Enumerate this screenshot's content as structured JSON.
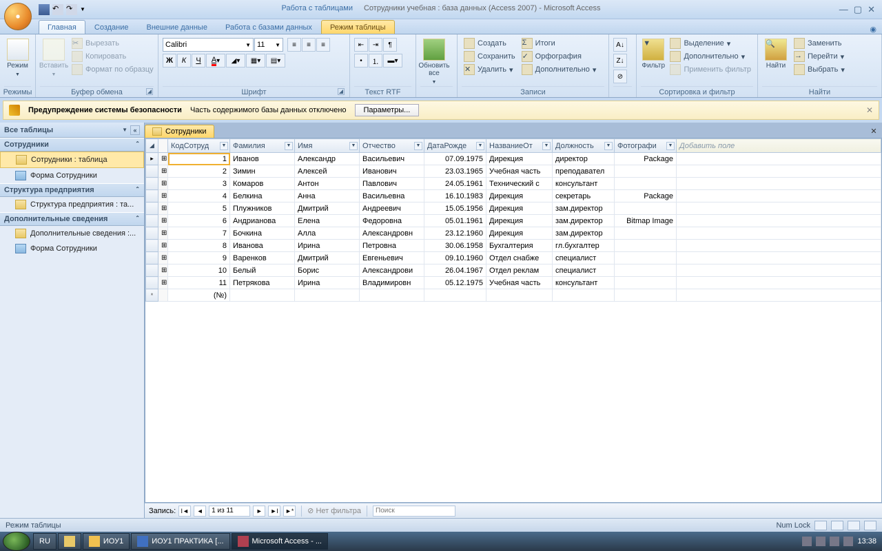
{
  "title": {
    "context_tab": "Работа с таблицами",
    "document": "Сотрудники учебная : база данных (Access 2007) - Microsoft Access"
  },
  "tabs": {
    "home": "Главная",
    "create": "Создание",
    "external": "Внешние данные",
    "dbtools": "Работа с базами данных",
    "tablemode": "Режим таблицы"
  },
  "ribbon": {
    "mode": "Режим",
    "modes": "Режимы",
    "paste": "Вставить",
    "cut": "Вырезать",
    "copy": "Копировать",
    "formatpainter": "Формат по образцу",
    "clipboard": "Буфер обмена",
    "font_name": "Calibri",
    "font_size": "11",
    "font": "Шрифт",
    "rtf": "Текст RTF",
    "refresh": "Обновить все",
    "new": "Создать",
    "save": "Сохранить",
    "delete": "Удалить",
    "totals": "Итоги",
    "spelling": "Орфография",
    "more": "Дополнительно",
    "records": "Записи",
    "filter": "Фильтр",
    "selection": "Выделение",
    "advanced": "Дополнительно",
    "toggle": "Применить фильтр",
    "sortfilter": "Сортировка и фильтр",
    "find": "Найти",
    "replace": "Заменить",
    "goto": "Перейти",
    "select": "Выбрать",
    "findgrp": "Найти"
  },
  "security": {
    "title": "Предупреждение системы безопасности",
    "msg": "Часть содержимого базы данных отключено",
    "btn": "Параметры..."
  },
  "nav": {
    "header": "Все таблицы",
    "g1": "Сотрудники",
    "g1i1": "Сотрудники : таблица",
    "g1i2": "Форма Сотрудники",
    "g2": "Структура предприятия",
    "g2i1": "Структура предприятия : та...",
    "g3": "Дополнительные сведения",
    "g3i1": "Дополнительные сведения :...",
    "g3i2": "Форма Сотрудники"
  },
  "doc_tab": "Сотрудники",
  "columns": [
    "КодСотруд",
    "Фамилия",
    "Имя",
    "Отчество",
    "ДатаРожде",
    "НазваниеОт",
    "Должность",
    "Фотографи"
  ],
  "addcol": "Добавить поле",
  "rows": [
    {
      "id": "1",
      "f": "Иванов",
      "i": "Александр",
      "o": "Васильевич",
      "d": "07.09.1975",
      "dep": "Дирекция",
      "pos": "директор",
      "ph": "Package"
    },
    {
      "id": "2",
      "f": "Зимин",
      "i": "Алексей",
      "o": "Иванович",
      "d": "23.03.1965",
      "dep": "Учебная часть",
      "pos": "преподавател",
      "ph": ""
    },
    {
      "id": "3",
      "f": "Комаров",
      "i": "Антон",
      "o": "Павлович",
      "d": "24.05.1961",
      "dep": "Технический с",
      "pos": "консультант",
      "ph": ""
    },
    {
      "id": "4",
      "f": "Белкина",
      "i": "Анна",
      "o": "Васильевна",
      "d": "16.10.1983",
      "dep": "Дирекция",
      "pos": "секретарь",
      "ph": "Package"
    },
    {
      "id": "5",
      "f": "Плужников",
      "i": "Дмитрий",
      "o": "Андреевич",
      "d": "15.05.1956",
      "dep": "Дирекция",
      "pos": "зам.директор",
      "ph": ""
    },
    {
      "id": "6",
      "f": "Андрианова",
      "i": "Елена",
      "o": "Федоровна",
      "d": "05.01.1961",
      "dep": "Дирекция",
      "pos": "зам.директор",
      "ph": "Bitmap Image"
    },
    {
      "id": "7",
      "f": "Бочкина",
      "i": "Алла",
      "o": "Александровн",
      "d": "23.12.1960",
      "dep": "Дирекция",
      "pos": "зам.директор",
      "ph": ""
    },
    {
      "id": "8",
      "f": "Иванова",
      "i": "Ирина",
      "o": "Петровна",
      "d": "30.06.1958",
      "dep": "Бухгалтерия",
      "pos": "гл.бухгалтер",
      "ph": ""
    },
    {
      "id": "9",
      "f": "Варенков",
      "i": "Дмитрий",
      "o": "Евгеньевич",
      "d": "09.10.1960",
      "dep": "Отдел снабже",
      "pos": "специалист",
      "ph": ""
    },
    {
      "id": "10",
      "f": "Белый",
      "i": "Борис",
      "o": "Александрови",
      "d": "26.04.1967",
      "dep": "Отдел реклам",
      "pos": "специалист",
      "ph": ""
    },
    {
      "id": "11",
      "f": "Петрякова",
      "i": "Ирина",
      "o": "Владимировн",
      "d": "05.12.1975",
      "dep": "Учебная часть",
      "pos": "консультант",
      "ph": ""
    }
  ],
  "newrow_id": "(№)",
  "recnav": {
    "label": "Запись:",
    "pos": "1 из 11",
    "nofilter": "Нет фильтра",
    "search": "Поиск"
  },
  "status": {
    "mode": "Режим таблицы",
    "numlock": "Num Lock"
  },
  "taskbar": {
    "lang": "RU",
    "t1": "ИОУ1",
    "t2": "ИОУ1 ПРАКТИКА [...",
    "t3": "Microsoft Access - ...",
    "time": "13:38"
  }
}
